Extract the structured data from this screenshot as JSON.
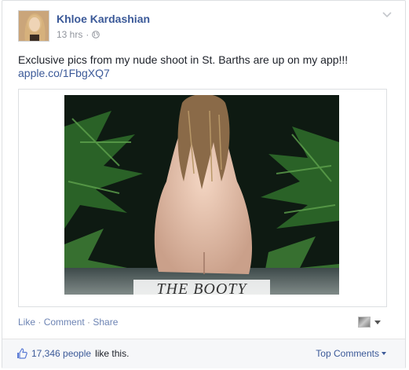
{
  "post": {
    "author": "Khloe Kardashian",
    "time": "13 hrs",
    "separator": "·",
    "text": "Exclusive pics from my nude shoot in St. Barths are up on my app!!!",
    "link": "apple.co/1FbgXQ7",
    "image_caption": "THE BOOTY",
    "icons": {
      "audience": "globe-icon",
      "menu": "chevron-down-icon",
      "like": "thumbs-up-icon"
    }
  },
  "actions": {
    "like": "Like",
    "comment": "Comment",
    "share": "Share",
    "sep": " · "
  },
  "footer": {
    "likes_count": "17,346 people",
    "likes_suffix": "like this.",
    "top_comments": "Top Comments"
  },
  "colors": {
    "link": "#3b5998",
    "meta": "#90949c",
    "footer_bg": "#f6f7f9"
  }
}
